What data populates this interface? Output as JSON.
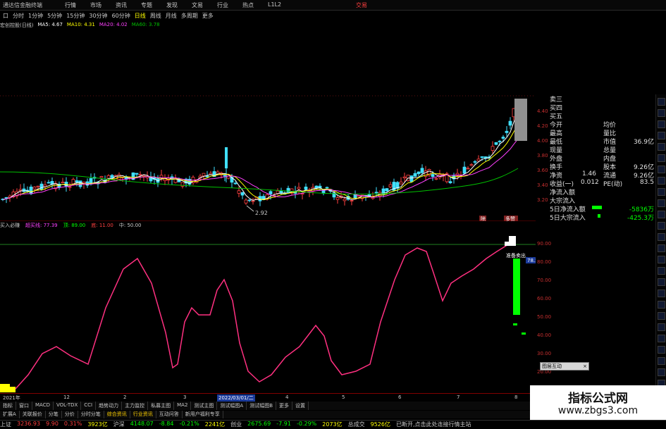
{
  "titlebar": {
    "app": "通达信金融终端",
    "menu": [
      "行情",
      "市场",
      "资讯",
      "专题",
      "发现",
      "文易",
      "行业",
      "热点",
      "L1L2"
    ],
    "trade": "交易"
  },
  "toolbar": {
    "items": [
      "口",
      "分时",
      "1分钟",
      "5分钟",
      "15分钟",
      "30分钟",
      "60分钟",
      "日线",
      "周线",
      "月线",
      "多周期",
      "更多"
    ],
    "active_index": 7
  },
  "ma_bar": {
    "stock": "宏创控股(日线)",
    "ma5": "MA5: 4.67",
    "ma10": "MA10: 4.31",
    "ma20": "MA20: 4.02",
    "ma60": "MA60: 3.78"
  },
  "colors": {
    "ma5": "#ffffff",
    "ma10": "#ffff00",
    "ma20": "#ff40ff",
    "ma60": "#00c000",
    "up": "#ff4040",
    "down": "#40e0ff",
    "osc_line": "#ff3080",
    "bar_green": "#00ff00"
  },
  "kline": {
    "min_label": "2.92",
    "flags": [
      "除",
      "多赞"
    ]
  },
  "price_axis": [
    "4.40",
    "4.20",
    "4.00",
    "3.80",
    "3.60",
    "3.40",
    "3.20"
  ],
  "sub_header": {
    "name": "买入必赚",
    "val1": "超买线: 77.39",
    "val2": "顶: 89.00",
    "val3": "底: 11.00",
    "val4": "中: 50.00"
  },
  "osc_axis": [
    "90.00",
    "80.00",
    "70.00",
    "60.00",
    "50.00",
    "40.00",
    "30.00",
    "20.00"
  ],
  "osc_labels": {
    "sell_label": "准备卖出",
    "value_tag": "78.54"
  },
  "date_axis": {
    "labels": [
      "2021年",
      "12",
      "2",
      "3",
      "4",
      "5",
      "6",
      "7",
      "8"
    ],
    "selected": "2022/03/01/二"
  },
  "tabs1": [
    "指标",
    "窗口",
    "MACD",
    "VOL-TDX",
    "CCI",
    "趋势动力",
    "主力监控",
    "私募主图",
    "MA2",
    "测试主图",
    "测试幅图A",
    "测试幅图B",
    "更多",
    "设置"
  ],
  "tabs2": [
    "扩展A",
    "关联报价",
    "分笔",
    "分价",
    "分时分笔",
    "综合资讯",
    "行业资讯",
    "互动问答",
    "新用户福利专享"
  ],
  "tabs2_highlight": [
    5,
    6
  ],
  "right_panel": {
    "rows": [
      {
        "l": "卖三"
      },
      {
        "l": "买四"
      },
      {
        "l": "买五"
      },
      {
        "l": "今开",
        "m": "均价"
      },
      {
        "l": "最高",
        "m": "量比"
      },
      {
        "l": "最低",
        "m": "市值",
        "v": "36.9亿"
      },
      {
        "l": "现量",
        "m": "总量"
      },
      {
        "l": "外盘",
        "m": "内盘"
      },
      {
        "l": "换手",
        "m": "股本",
        "v": "9.26亿"
      },
      {
        "l": "净资",
        "lv": "1.46",
        "m": "流通",
        "v": "9.26亿"
      },
      {
        "l": "收益(一)",
        "lv": "0.012",
        "m": "PE(动)",
        "v": "83.5"
      },
      {
        "l": "净流入额"
      },
      {
        "l": "大宗流入"
      },
      {
        "l": "5日净流入额",
        "v": "-5836万"
      },
      {
        "l": "5日大宗流入",
        "v": "-425.3万"
      }
    ]
  },
  "mini_popup": {
    "label": "图层互动",
    "close": "×"
  },
  "statusbar": {
    "items": [
      {
        "t": "上证",
        "c": "#c8c8c8"
      },
      {
        "t": "3236.93",
        "c": "#ff4040"
      },
      {
        "t": "9.90",
        "c": "#ff4040"
      },
      {
        "t": "0.31%",
        "c": "#ff4040"
      },
      {
        "t": "3923亿",
        "c": "#ffff00"
      },
      {
        "t": "沪深",
        "c": "#c8c8c8"
      },
      {
        "t": "4148.07",
        "c": "#00ff00"
      },
      {
        "t": "-8.84",
        "c": "#00ff00"
      },
      {
        "t": "-0.21%",
        "c": "#00ff00"
      },
      {
        "t": "2241亿",
        "c": "#ffff00"
      },
      {
        "t": "创业",
        "c": "#c8c8c8"
      },
      {
        "t": "2675.69",
        "c": "#00ff00"
      },
      {
        "t": "-7.91",
        "c": "#00ff00"
      },
      {
        "t": "-0.29%",
        "c": "#00ff00"
      },
      {
        "t": "2073亿",
        "c": "#ffff00"
      },
      {
        "t": "总成交",
        "c": "#c8c8c8"
      },
      {
        "t": "9526亿",
        "c": "#ffff00"
      },
      {
        "t": "已断开,点击此处连接行情主站",
        "c": "#c8c8c8"
      }
    ]
  },
  "watermark": {
    "title": "指标公式网",
    "url": "www.zbgs3.com"
  }
}
